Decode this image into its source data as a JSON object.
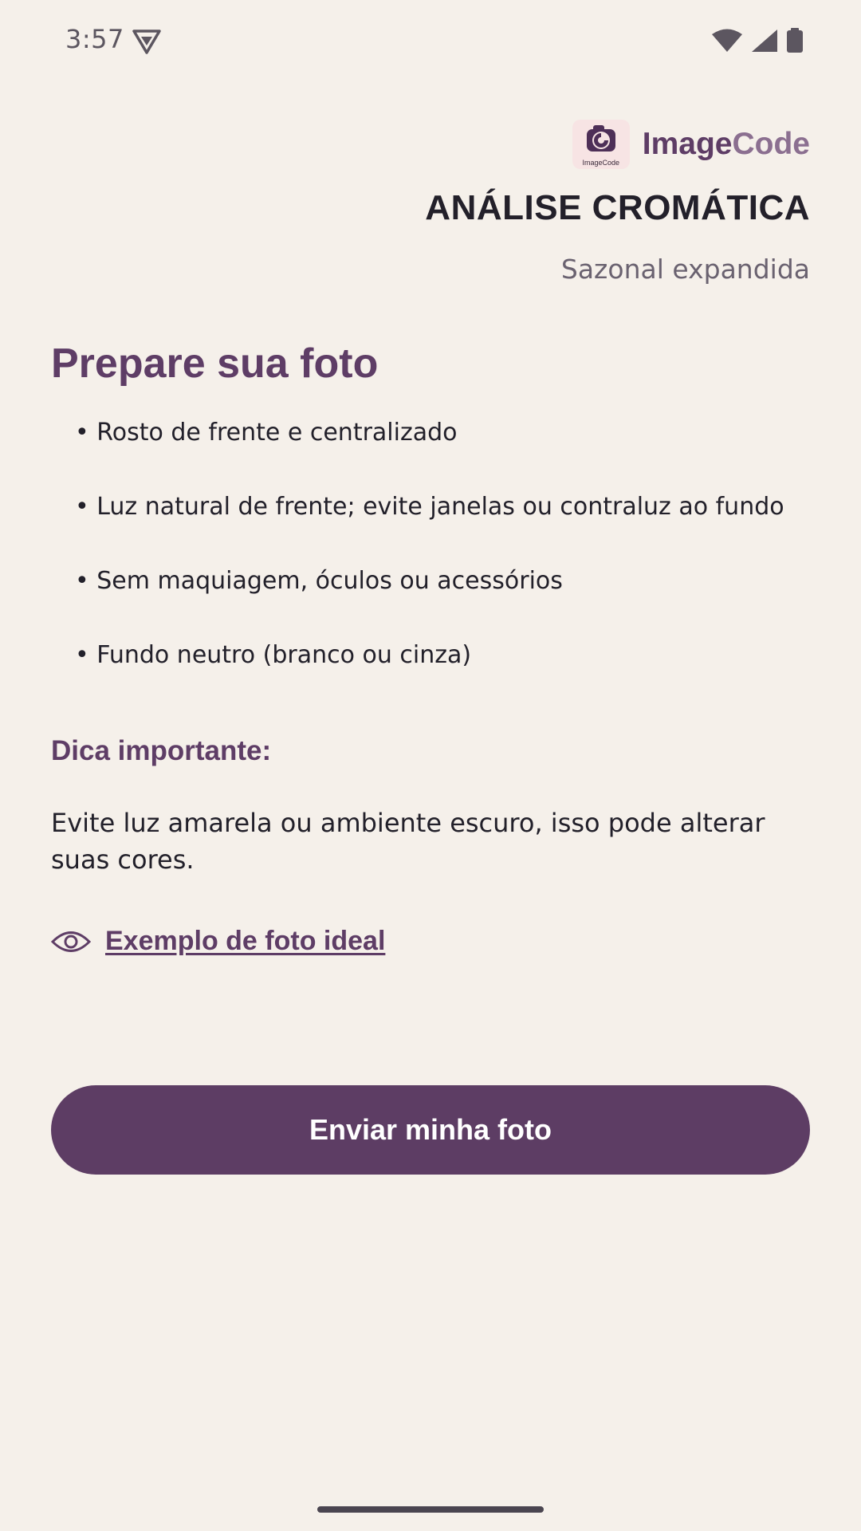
{
  "status_bar": {
    "time": "3:57",
    "icons": [
      "vpn-icon",
      "wifi-icon",
      "cellular-signal-icon",
      "battery-icon"
    ]
  },
  "brand": {
    "logo_text": "ImageCode",
    "name_part1": "Image",
    "name_part2": "Code"
  },
  "header": {
    "title": "ANÁLISE CROMÁTICA",
    "subtitle": "Sazonal expandida"
  },
  "main": {
    "section_title": "Prepare sua foto",
    "tips": [
      "• Rosto de frente e centralizado",
      "• Luz natural de frente; evite janelas ou contraluz ao fundo",
      "• Sem maquiagem, óculos ou acessórios",
      "• Fundo neutro (branco ou cinza)"
    ],
    "tip_heading": "Dica importante:",
    "tip_body": "Evite luz amarela ou ambiente escuro, isso pode alterar suas cores.",
    "example_link": "Exemplo de foto ideal",
    "example_icon": "eye-icon"
  },
  "actions": {
    "submit_label": "Enviar minha foto"
  },
  "colors": {
    "background": "#f5f0ea",
    "brand_primary": "#5e3d66",
    "brand_secondary": "#8b6f90",
    "button": "#5d3d64",
    "text": "#22202a"
  }
}
